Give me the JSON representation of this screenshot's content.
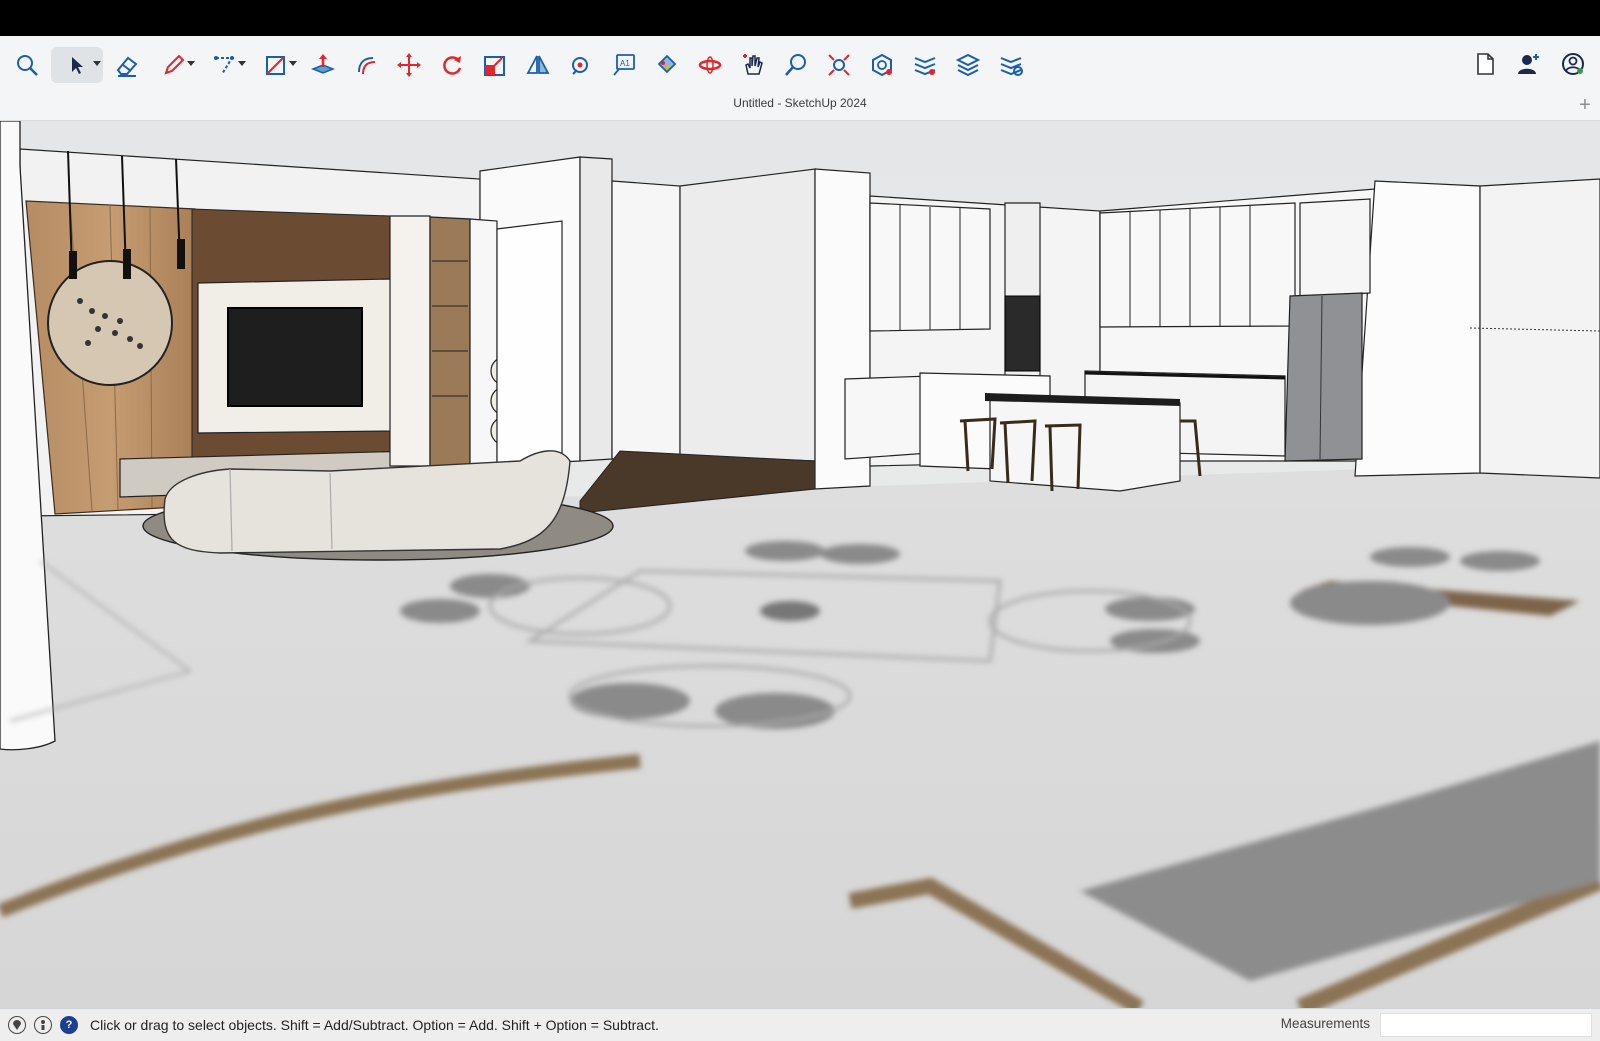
{
  "window": {
    "title": "Untitled - SketchUp 2024"
  },
  "toolbar": {
    "tools": [
      {
        "name": "search-tool",
        "icon": "magnifier-icon"
      },
      {
        "name": "select-tool",
        "icon": "arrow-cursor-icon",
        "active": true
      },
      {
        "name": "eraser-tool",
        "icon": "eraser-icon"
      },
      {
        "name": "line-tool",
        "icon": "pencil-icon"
      },
      {
        "name": "arc-tool",
        "icon": "arc-icon"
      },
      {
        "name": "shape-tool",
        "icon": "rectangle-icon"
      },
      {
        "name": "push-pull-tool",
        "icon": "push-pull-icon"
      },
      {
        "name": "offset-tool",
        "icon": "offset-icon"
      },
      {
        "name": "move-tool",
        "icon": "move-arrows-icon"
      },
      {
        "name": "rotate-tool",
        "icon": "rotate-icon"
      },
      {
        "name": "scale-tool",
        "icon": "scale-icon"
      },
      {
        "name": "flip-tool",
        "icon": "flip-icon"
      },
      {
        "name": "tape-measure-tool",
        "icon": "tape-measure-icon"
      },
      {
        "name": "text-tool",
        "icon": "text-icon"
      },
      {
        "name": "paint-bucket-tool",
        "icon": "paint-bucket-icon"
      },
      {
        "name": "orbit-tool",
        "icon": "orbit-icon"
      },
      {
        "name": "pan-tool",
        "icon": "hand-icon"
      },
      {
        "name": "zoom-tool",
        "icon": "zoom-icon"
      },
      {
        "name": "zoom-extents-tool",
        "icon": "zoom-extents-icon"
      },
      {
        "name": "components-tool",
        "icon": "components-icon"
      },
      {
        "name": "tags-tool",
        "icon": "tags-icon"
      },
      {
        "name": "layers-tool",
        "icon": "layers-icon"
      },
      {
        "name": "styles-tool",
        "icon": "styles-icon"
      }
    ],
    "right_tools": [
      {
        "name": "new-document",
        "icon": "document-icon"
      },
      {
        "name": "collaborate",
        "icon": "add-user-icon"
      },
      {
        "name": "account",
        "icon": "account-icon"
      }
    ],
    "add_tab": "+"
  },
  "statusbar": {
    "message": "Click or drag to select objects. Shift = Add/Subtract. Option = Add. Shift + Option = Subtract.",
    "measurements_label": "Measurements",
    "measurements_value": ""
  },
  "colors": {
    "accent_red": "#e3262b",
    "accent_blue": "#1b5fa8",
    "floor": "#d9d9d9",
    "wood": "#a07a55"
  }
}
